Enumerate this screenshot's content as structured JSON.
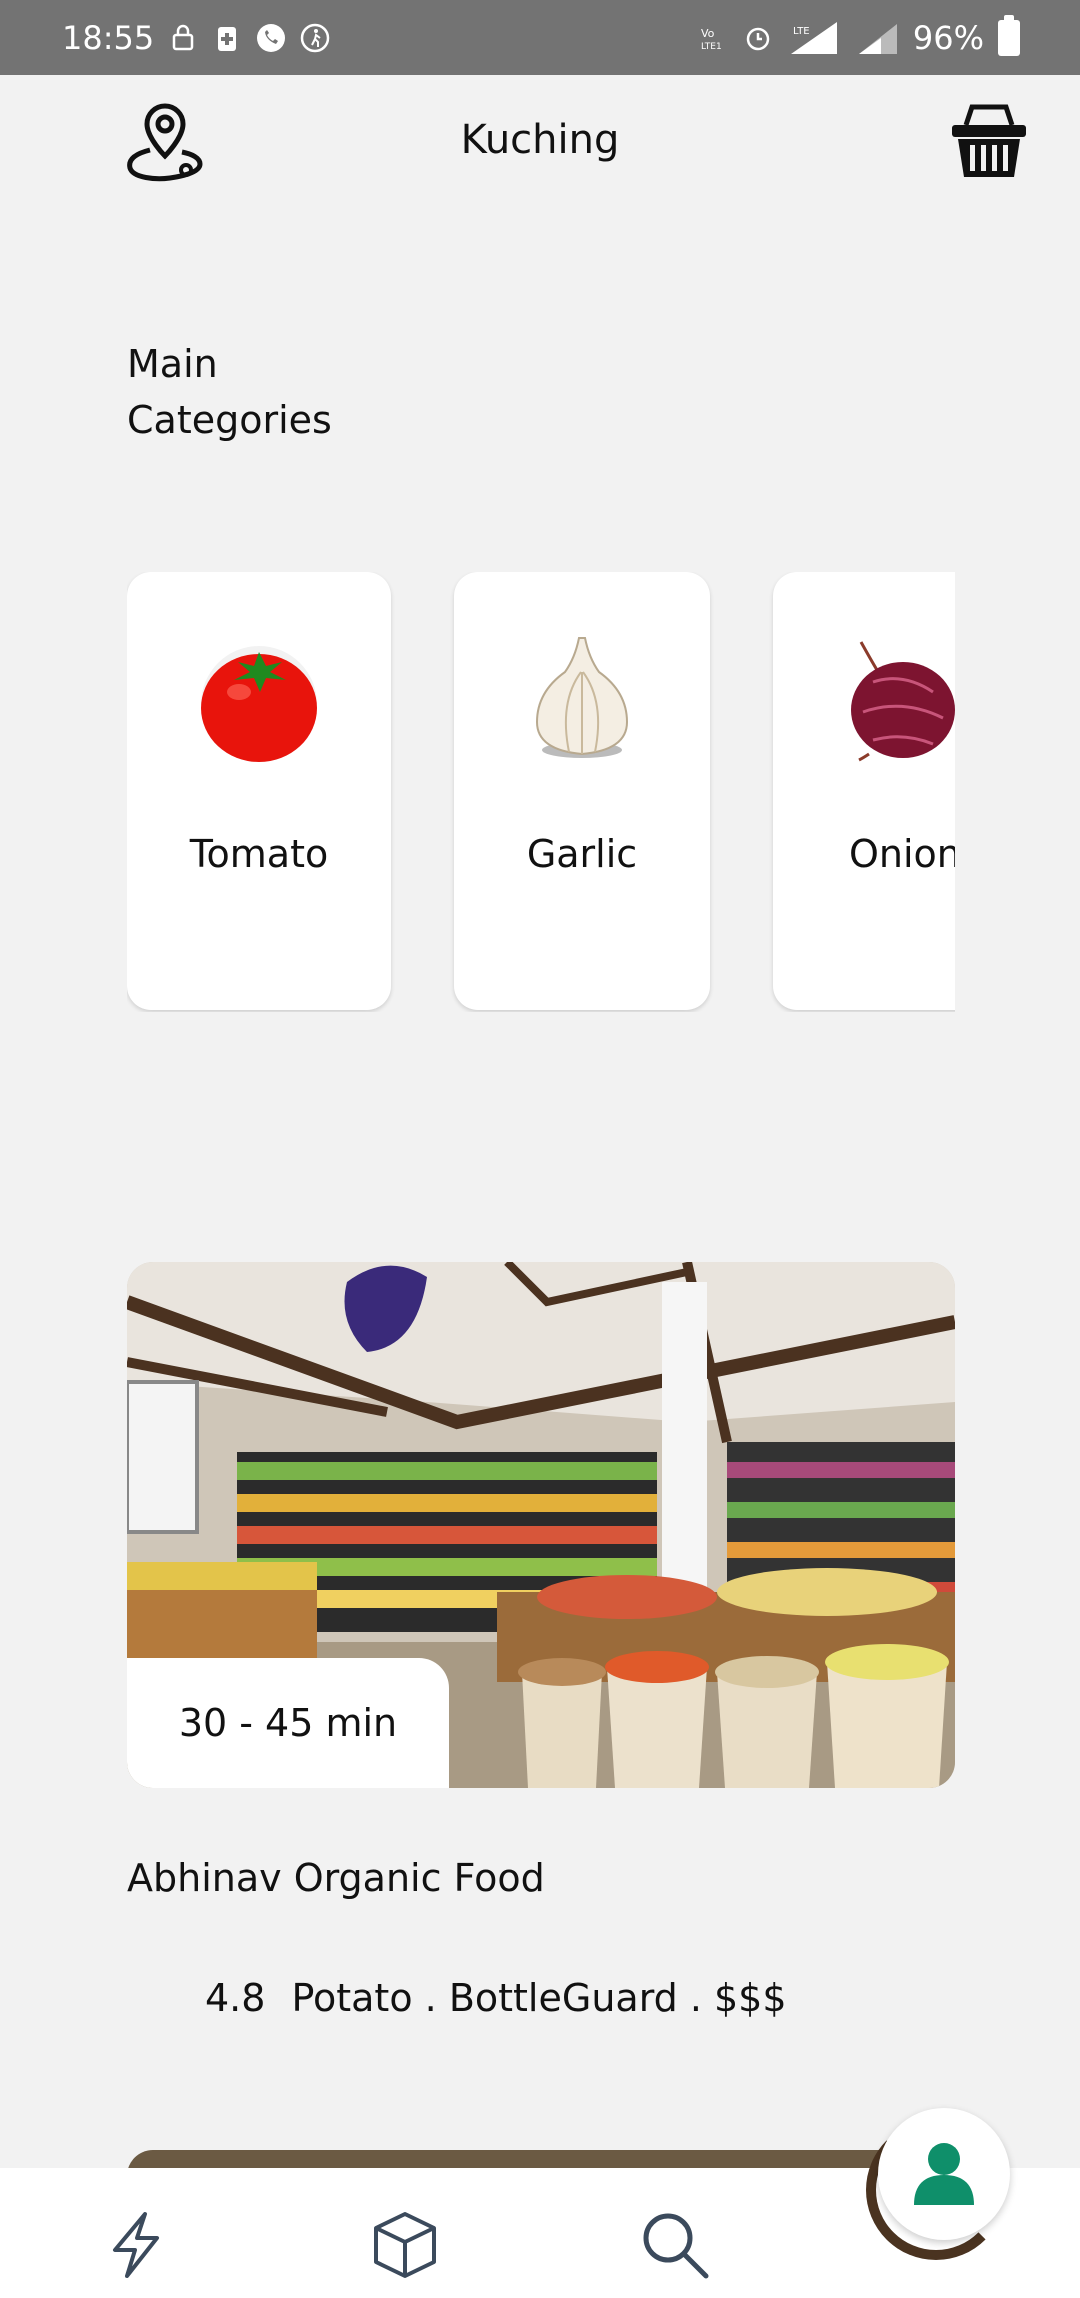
{
  "status_bar": {
    "time": "18:55",
    "battery": "96%"
  },
  "header": {
    "city": "Kuching",
    "location_icon": "location-pin-icon",
    "cart_icon": "shopping-basket-icon"
  },
  "categories": {
    "title": "Main\nCategories",
    "items": [
      {
        "label": "Tomato",
        "icon": "tomato-image"
      },
      {
        "label": "Garlic",
        "icon": "garlic-image"
      },
      {
        "label": "Onion",
        "icon": "onion-image"
      }
    ]
  },
  "store": {
    "eta": "30 - 45 min",
    "name": "Abhinav Organic Food",
    "rating": "4.8",
    "tags": "Potato . BottleGuard . $$$"
  },
  "bottom_nav": {
    "items": [
      "flash-icon",
      "box-icon",
      "search-icon"
    ],
    "profile_icon": "user-icon"
  },
  "colors": {
    "accent": "#0f8f6a",
    "status_bar": "#737373",
    "background": "#f2f2f2"
  }
}
